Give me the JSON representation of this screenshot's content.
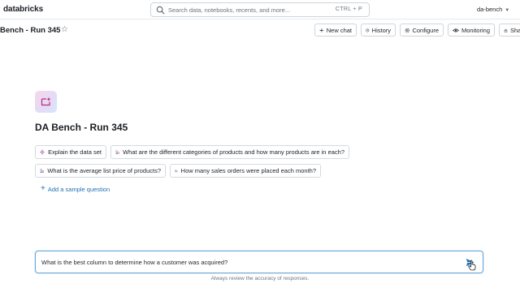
{
  "app": {
    "logo": "databricks",
    "account": "da-bench"
  },
  "search": {
    "placeholder": "Search data, notebooks, recents, and more...",
    "shortcut": "CTRL + P"
  },
  "header": {
    "title": "Bench - Run 345",
    "buttons": {
      "new_chat": "New chat",
      "history": "History",
      "configure": "Configure",
      "monitoring": "Monitoring",
      "share": "Share"
    }
  },
  "space": {
    "title": "DA Bench - Run 345",
    "sample_questions": [
      {
        "label": "Explain the data set",
        "icon": "sparkle-icon"
      },
      {
        "label": "What are the different categories of products and how many products are in each?",
        "icon": "shapes-icon"
      },
      {
        "label": "What is the average list price of products?",
        "icon": "shapes-icon"
      },
      {
        "label": "How many sales orders were placed each month?",
        "icon": "shapes-icon"
      }
    ],
    "add_sample_label": "Add a sample question"
  },
  "prompt": {
    "value": "What is the best column to determine how a customer was acquired?",
    "disclaimer": "Always review the accuracy of responses."
  },
  "colors": {
    "link": "#2272b4",
    "focus_border": "#6aa8d8",
    "icon_gradient_start": "#f7d6e8",
    "icon_gradient_end": "#d7e6fb"
  }
}
